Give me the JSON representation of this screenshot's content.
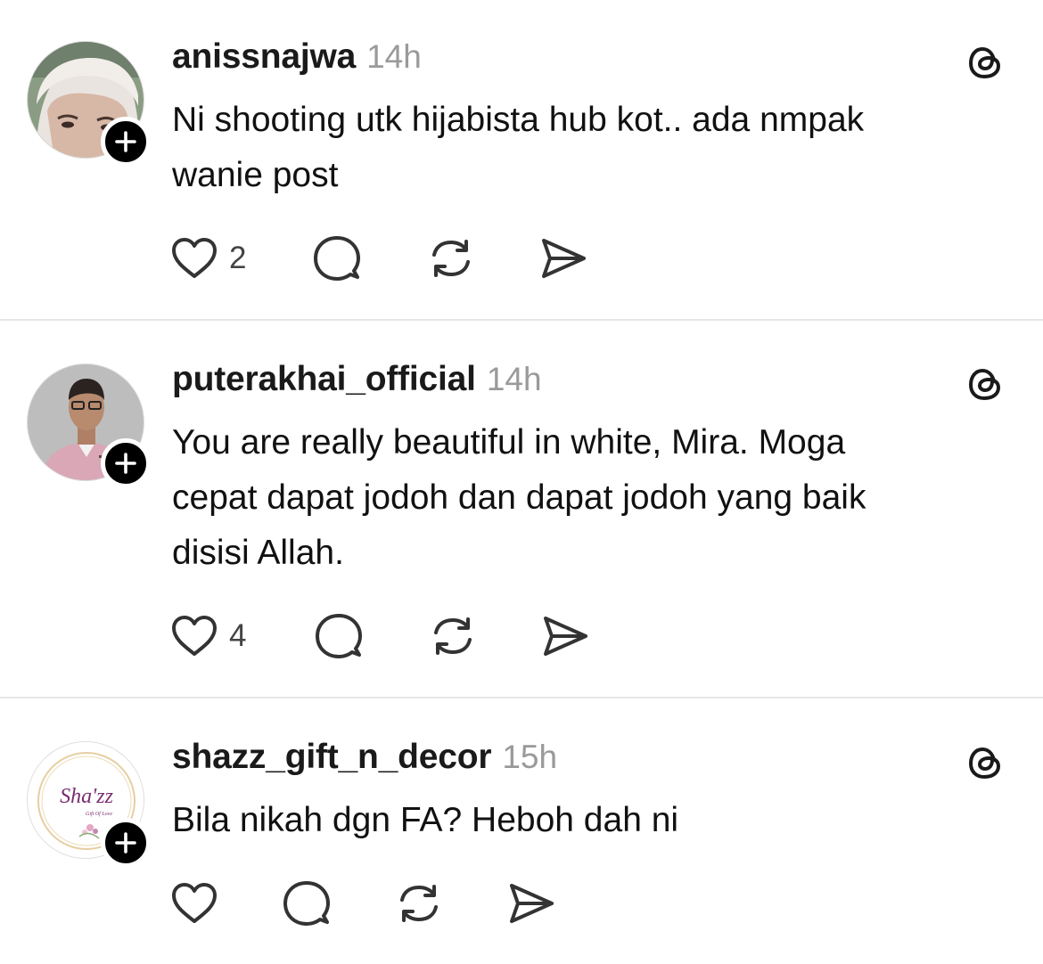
{
  "posts": [
    {
      "username": "anissnajwa",
      "time": "14h",
      "text_lines": [
        "Ni shooting utk hijabista hub kot.. ada nmpak",
        "wanie post"
      ],
      "likes": "2",
      "avatar_icon": "user-avatar-hijab"
    },
    {
      "username": "puterakhai_official",
      "time": "14h",
      "text_lines": [
        "You are really beautiful in white, Mira. Moga",
        "cepat dapat jodoh dan dapat jodoh yang baik",
        "disisi Allah."
      ],
      "likes": "4",
      "avatar_icon": "user-avatar-man"
    },
    {
      "username": "shazz_gift_n_decor",
      "time": "15h",
      "text_lines": [
        "Bila nikah dgn FA? Heboh dah ni"
      ],
      "likes": "",
      "avatar_icon": "shop-logo-avatar",
      "logo_text": "Sha'zz",
      "logo_subtext": "Gift Of Love"
    }
  ],
  "colors": {
    "text": "#111111",
    "username": "#1a1a1a",
    "timestamp": "#9a9a9a",
    "icon": "#333333",
    "divider": "#e6e6e6",
    "follow_badge": "#000000",
    "logo_purple": "#7a2d6e"
  },
  "icons": {
    "like": "heart-icon",
    "reply": "comment-icon",
    "repost": "repost-icon",
    "share": "send-icon",
    "brand": "threads-icon",
    "follow": "plus-icon"
  }
}
